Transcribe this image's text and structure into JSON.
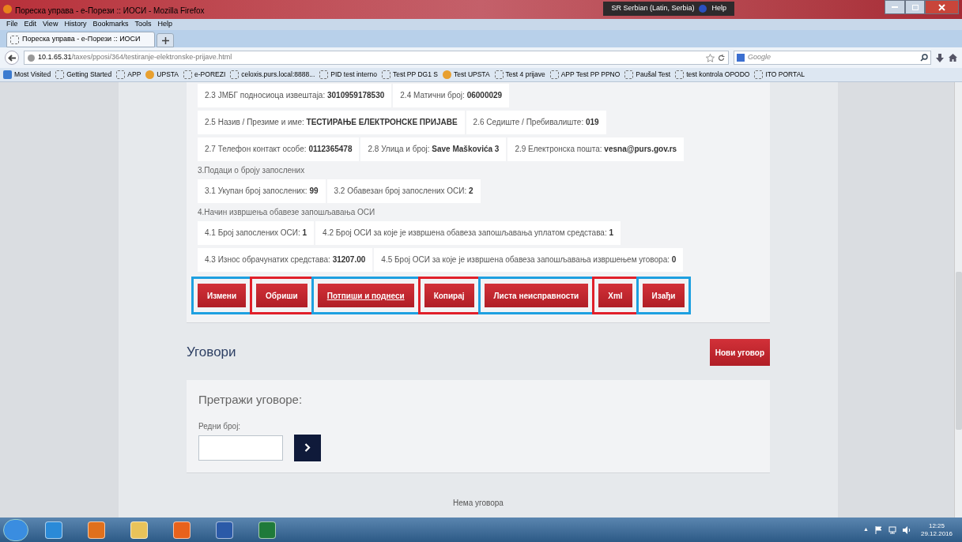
{
  "window": {
    "title": "Пореска управа - е-Порези :: ИОСИ - Mozilla Firefox",
    "controls": [
      {
        "kind": "minimize"
      },
      {
        "kind": "maximize"
      },
      {
        "kind": "close"
      }
    ]
  },
  "language_bar": {
    "language": "SR Serbian (Latin, Serbia)",
    "help": "Help"
  },
  "menu": [
    "File",
    "Edit",
    "View",
    "History",
    "Bookmarks",
    "Tools",
    "Help"
  ],
  "tabs": [
    {
      "label": "Пореска управа - е-Порези :: ИОСИ",
      "selected": true
    }
  ],
  "address": {
    "host": "10.1.65.31",
    "path": "/taxes/pposi/364/testiranje-elektronske-prijave.html"
  },
  "search": {
    "placeholder": "Google"
  },
  "bookmarks": [
    {
      "label": "Most Visited",
      "kind": "special"
    },
    {
      "label": "Getting Started",
      "kind": "folder"
    },
    {
      "label": "APP",
      "kind": "folder"
    },
    {
      "label": "UPSTA",
      "kind": "site"
    },
    {
      "label": "e-POREZI",
      "kind": "folder"
    },
    {
      "label": "celoxis.purs.local:8888...",
      "kind": "folder"
    },
    {
      "label": "PID test interno",
      "kind": "folder"
    },
    {
      "label": "Test PP DG1 S",
      "kind": "folder"
    },
    {
      "label": "Test UPSTA",
      "kind": "site"
    },
    {
      "label": "Test 4 prijave",
      "kind": "folder"
    },
    {
      "label": "APP Test PP PPNO",
      "kind": "folder"
    },
    {
      "label": "Paušal Test",
      "kind": "folder"
    },
    {
      "label": "test kontrola OPODO",
      "kind": "folder"
    },
    {
      "label": "ITO PORTAL",
      "kind": "folder"
    }
  ],
  "report": [
    {
      "kind": "row",
      "cells": [
        {
          "label": "2.3 ЈМБГ подносиоца извештаја:",
          "value": "3010959178530"
        },
        {
          "label": "2.4 Матични број:",
          "value": "06000029"
        }
      ]
    },
    {
      "kind": "row",
      "cells": [
        {
          "label": "2.5 Назив / Презиме и име:",
          "value": "ТЕСТИРАЊЕ ЕЛЕКТРОНСКЕ ПРИЈАВЕ"
        },
        {
          "label": "2.6 Седиште / Пребивалиште:",
          "value": "019"
        }
      ]
    },
    {
      "kind": "row",
      "cells": [
        {
          "label": "2.7 Телефон контакт особе:",
          "value": "0112365478"
        },
        {
          "label": "2.8 Улица и број:",
          "value": "Save Maškovića 3"
        },
        {
          "label": "2.9 Електронска пошта:",
          "value": "vesna@purs.gov.rs"
        }
      ]
    },
    {
      "kind": "heading",
      "text": "3.Подаци о броју запослених"
    },
    {
      "kind": "row",
      "cells": [
        {
          "label": "3.1 Укупан број запослених:",
          "value": "99"
        },
        {
          "label": "3.2 Обавезан број запослених ОСИ:",
          "value": "2"
        }
      ]
    },
    {
      "kind": "heading",
      "text": "4.Начин извршења обавезе запошљавања ОСИ"
    },
    {
      "kind": "row",
      "cells": [
        {
          "label": "4.1 Број запослених ОСИ:",
          "value": "1"
        },
        {
          "label": "4.2 Број ОСИ за које је извршена обавеза запошљавања уплатом средстава:",
          "value": "1"
        }
      ]
    },
    {
      "kind": "row",
      "cells": [
        {
          "label": "4.3 Износ обрачунатих средстава:",
          "value": "31207.00"
        },
        {
          "label": "4.5 Број ОСИ за које је извршена обавеза запошљавања извршењем уговора:",
          "value": "0"
        }
      ]
    }
  ],
  "actions": [
    {
      "label": "Измени",
      "underlined": false,
      "color": "#1ea0e0"
    },
    {
      "label": "Обриши",
      "underlined": false,
      "color": "#e0202a"
    },
    {
      "label": "Потпиши и поднеси",
      "underlined": true,
      "color": "#1ea0e0"
    },
    {
      "label": "Копирај",
      "underlined": false,
      "color": "#e0202a"
    },
    {
      "label": "Листа неисправности",
      "underlined": false,
      "color": "#1ea0e0"
    },
    {
      "label": "Xml",
      "underlined": false,
      "color": "#e0202a"
    },
    {
      "label": "Изађи",
      "underlined": false,
      "color": "#1ea0e0"
    }
  ],
  "contracts": {
    "title": "Уговори",
    "new_button": "Нови уговор",
    "search_title": "Претражи уговоре:",
    "field_label": "Редни број:",
    "empty": "Нема уговора"
  },
  "taskbar": {
    "tray": [
      "▲"
    ],
    "apps": [
      {
        "kind": "ie"
      },
      {
        "kind": "firefox"
      },
      {
        "kind": "explorer"
      },
      {
        "kind": "media"
      },
      {
        "kind": "word"
      },
      {
        "kind": "excel"
      }
    ],
    "time": "12:25",
    "date": "29.12.2016"
  }
}
